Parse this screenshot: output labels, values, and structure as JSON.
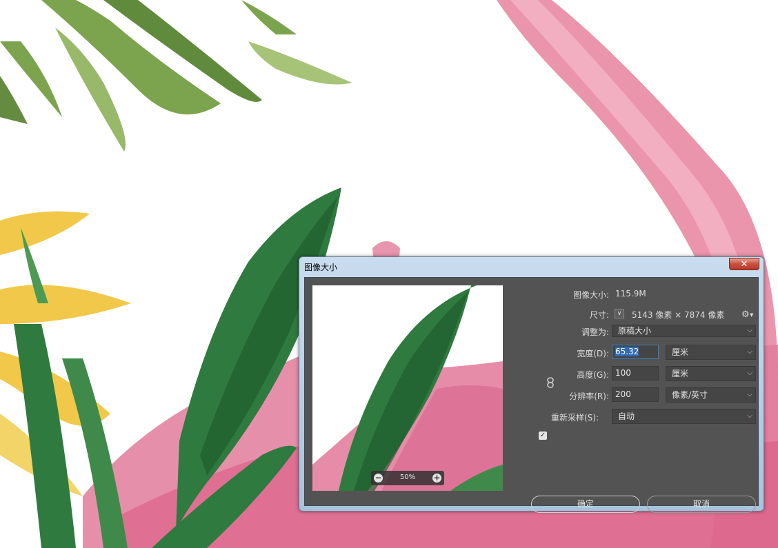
{
  "dialog": {
    "title": "图像大小",
    "close_label": "✕",
    "image_size_label": "图像大小:",
    "image_size_value": "115.9M",
    "dimensions_label": "尺寸:",
    "dimensions_value": "5143 像素  ×  7874 像素",
    "fit_to_label": "调整为:",
    "fit_to_value": "原稿大小",
    "width_label": "宽度(D):",
    "width_value": "65.32",
    "width_unit": "厘米",
    "height_label": "高度(G):",
    "height_value": "100",
    "height_unit": "厘米",
    "resolution_label": "分辨率(R):",
    "resolution_value": "200",
    "resolution_unit": "像素/英寸",
    "resample_label": "重新采样(S):",
    "resample_checked": true,
    "resample_value": "自动",
    "ok_label": "确定",
    "cancel_label": "取消",
    "zoom_level": "50%",
    "zoom_out_icon": "minus-circle-icon",
    "zoom_in_icon": "plus-circle-icon",
    "settings_icon": "gear-icon",
    "link_icon": "chain-link-icon",
    "chevron_icon": "chevron-down-icon"
  },
  "colors": {
    "dialog_body": "#535353",
    "field_bg": "#454545",
    "title_glass": "#c9dcef",
    "close_button": "#c9503d",
    "leaf_green": "#2f7a3f",
    "pink_brush": "#e06a8c",
    "yellow_petal": "#f0c640"
  }
}
